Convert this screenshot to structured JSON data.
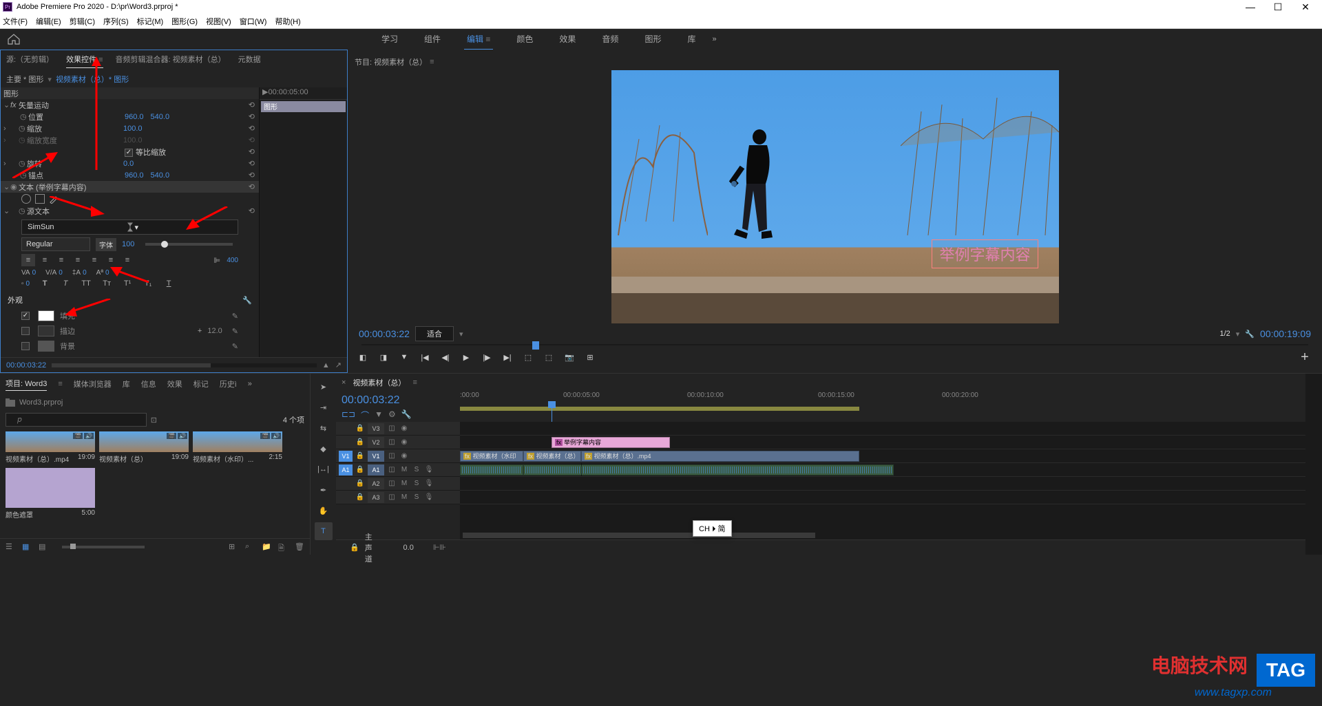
{
  "title_bar": {
    "app_icon_text": "Pr",
    "title": "Adobe Premiere Pro 2020 - D:\\pr\\Word3.prproj *"
  },
  "menus": [
    "文件(F)",
    "编辑(E)",
    "剪辑(C)",
    "序列(S)",
    "标记(M)",
    "图形(G)",
    "视图(V)",
    "窗口(W)",
    "帮助(H)"
  ],
  "workspaces": {
    "items": [
      "学习",
      "组件",
      "编辑",
      "颜色",
      "效果",
      "音频",
      "图形",
      "库"
    ],
    "active_index": 2,
    "more": "»"
  },
  "left_tabs": {
    "items": [
      "源:（无剪辑）",
      "效果控件",
      "音频剪辑混合器: 视频素材（总）",
      "元数据"
    ],
    "active_index": 1
  },
  "breadcrumb": {
    "main": "主要 * 图形",
    "seq": "视频素材（总）* 图形",
    "play_arrow": "▶"
  },
  "ec_time_header": "▶00:00:05:00",
  "ec_clip_label": "图形",
  "props": {
    "section_graphics": "图形",
    "vector_motion": "矢量运动",
    "position": {
      "label": "位置",
      "x": "960.0",
      "y": "540.0"
    },
    "scale": {
      "label": "缩放",
      "val": "100.0"
    },
    "scale_w": {
      "label": "缩放宽度",
      "val": "100.0",
      "uniform_check_label": "等比缩放"
    },
    "rotation": {
      "label": "旋转",
      "val": "0.0"
    },
    "anchor": {
      "label": "锚点",
      "x": "960.0",
      "y": "540.0"
    },
    "text_section": "文本 (举例字幕内容)",
    "source_text": "源文本",
    "font_family": "SimSun",
    "font_style": "Regular",
    "font_badge": "字体",
    "font_size": "100",
    "track_num": "400",
    "metrics": {
      "va1": "0",
      "va2": "0",
      "la": "0",
      "aa": "0",
      "ml": "0"
    },
    "appearance": "外观",
    "fill": {
      "label": "填充",
      "color": "#ffffff"
    },
    "stroke": {
      "label": "描边",
      "color": "#333333",
      "width": "12.0"
    },
    "bg": {
      "label": "背景",
      "color": "#555555"
    }
  },
  "ec_bottom_time": "00:00:03:22",
  "program": {
    "tab": "节目: 视频素材（总）",
    "subtitle_text": "举例字幕内容",
    "timecode": "00:00:03:22",
    "fit": "适合",
    "scale": "1/2",
    "duration": "00:00:19:09"
  },
  "project": {
    "tabs": [
      "项目: Word3",
      "媒体浏览器",
      "库",
      "信息",
      "效果",
      "标记",
      "历史ì"
    ],
    "active_index": 0,
    "path": "Word3.prproj",
    "item_count": "4 个项",
    "search_placeholder": "𝘱",
    "items": [
      {
        "name": "视频素材（总）.mp4",
        "dur": "19:09"
      },
      {
        "name": "视频素材（总）",
        "dur": "19:09"
      },
      {
        "name": "视频素材（水印）...",
        "dur": "2:15"
      },
      {
        "name": "颜色遮罩",
        "dur": "5:00"
      }
    ]
  },
  "timeline": {
    "name": "视频素材（总）",
    "timecode": "00:00:03:22",
    "ruler": [
      ":00:00",
      "00:00:05:00",
      "00:00:10:00",
      "00:00:15:00",
      "00:00:20:00"
    ],
    "tracks": {
      "v3": "V3",
      "v2": "V2",
      "v1": "V1",
      "a1": "A1",
      "a2": "A2",
      "a3": "A3",
      "src_v1": "V1",
      "src_a1": "A1"
    },
    "clips": {
      "graphic": "举例字幕内容",
      "v1_a": "视频素材（水印",
      "v1_b": "视频素材（总）",
      "v1_c": "视频素材（总）.mp4"
    },
    "master": {
      "label": "主声道",
      "val": "0.0"
    }
  },
  "ime": "CH ⏵ 简",
  "watermark": {
    "red": "电脑技术网",
    "url": "www.tagxp.com",
    "tag": "TAG"
  },
  "icons": {
    "reset": "⟲",
    "clock": "◷",
    "wrench": "🔧",
    "plus": "+",
    "eyedrop": "✎",
    "lock": "🔒",
    "eye": "👁",
    "mute": "M",
    "solo": "S",
    "rec": "●",
    "home": "⌂",
    "chevron": "▾",
    "more": "»",
    "mag": "⌕"
  }
}
